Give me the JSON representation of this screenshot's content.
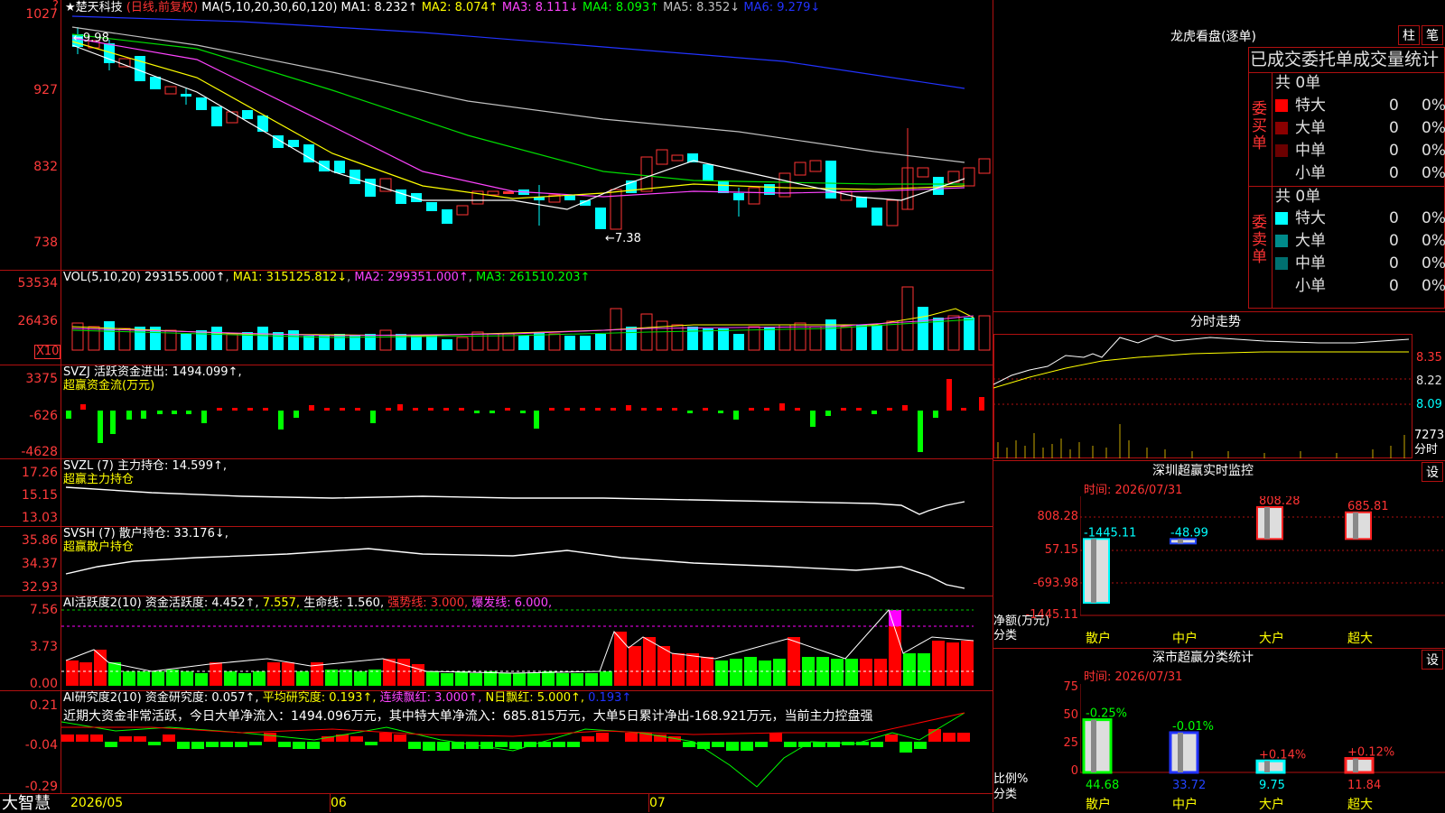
{
  "colors": {
    "up": "#ff3333",
    "down": "#00ffff",
    "ma1": "#ffffff",
    "ma2": "#ffff00",
    "ma3": "#ff44ff",
    "ma4": "#00dd00",
    "ma5": "#c0c0c0",
    "ma6": "#2233ff",
    "grid": "#b01010"
  },
  "main": {
    "stock_name": "楚天科技",
    "period_text": "(日线,前复权)",
    "ma_params": "MA(5,10,20,30,60,120)",
    "ma1": "MA1: 8.232↑",
    "ma2": "MA2: 8.074↑",
    "ma3": "MA3: 8.111↓",
    "ma4": "MA4: 8.093↑",
    "ma5": "MA5: 8.352↓",
    "ma6": "MA6: 9.279↓",
    "y_ticks": [
      "1027",
      "927",
      "832",
      "738"
    ],
    "high_label": "←9.98",
    "low_label": "←7.38"
  },
  "vol": {
    "title": "VOL(5,10,20)",
    "value": "293155.000↑",
    "ma1": "MA1: 315125.812↓",
    "ma2": "MA2: 299351.000↑",
    "ma3": "MA3: 261510.203↑",
    "y_ticks": [
      "53534",
      "26436"
    ],
    "unit": "X10"
  },
  "svzj": {
    "title": "SVZJ 活跃资金进出: 1494.099↑,",
    "subtitle": "超赢资金流(万元)",
    "y_ticks": [
      "3375",
      "-626",
      "-4628"
    ]
  },
  "svzl": {
    "title": "SVZL (7) 主力持仓: 14.599↑,",
    "subtitle": "超赢主力持仓",
    "y_ticks": [
      "17.26",
      "15.15",
      "13.03"
    ]
  },
  "svsh": {
    "title": "SVSH (7) 散户持仓: 33.176↓,",
    "subtitle": "超赢散户持仓",
    "y_ticks": [
      "35.86",
      "34.37",
      "32.93"
    ]
  },
  "ai1": {
    "title": "AI活跃度2(10) 资金活跃度: 4.452↑,",
    "v2": "7.557,",
    "life": "生命线: 1.560,",
    "strong": "强势线: 3.000,",
    "burst": "爆发线: 6.000,",
    "y_ticks": [
      "7.56",
      "3.73",
      "0.00"
    ]
  },
  "ai2": {
    "title": "AI研究度2(10) 资金研究度: 0.057↑,",
    "avg": "平均研究度: 0.193↑,",
    "lianxu": "连续飘红: 3.000↑,",
    "nday": "N日飘红: 5.000↑,",
    "last": "0.193↑",
    "comment": "近期大资金非常活跃，今日大单净流入：1494.096万元，其中特大单净流入：685.815万元，大单5日累计净出-168.921万元，当前主力控盘强",
    "y_ticks": [
      "0.21",
      "-0.04",
      "-0.29"
    ]
  },
  "x_axis": {
    "labels": [
      "2026/05",
      "06",
      "07"
    ]
  },
  "brand": "大智慧",
  "lhb": {
    "title": "龙虎看盘(逐单)",
    "btn1": "柱",
    "btn2": "笔",
    "header": "已成交委托单成交量统计",
    "buy": {
      "side_label": "委买单",
      "total": "共 0单",
      "rows": [
        {
          "name": "特大",
          "count": "0",
          "pct": "0%",
          "color": "#ff0000"
        },
        {
          "name": "大单",
          "count": "0",
          "pct": "0%",
          "color": "#8b0000"
        },
        {
          "name": "中单",
          "count": "0",
          "pct": "0%",
          "color": "#6b0000"
        },
        {
          "name": "小单",
          "count": "0",
          "pct": "0%",
          "color": "#000000"
        }
      ]
    },
    "sell": {
      "side_label": "委卖单",
      "total": "共 0单",
      "rows": [
        {
          "name": "特大",
          "count": "0",
          "pct": "0%",
          "color": "#00ffff"
        },
        {
          "name": "大单",
          "count": "0",
          "pct": "0%",
          "color": "#008b8b"
        },
        {
          "name": "中单",
          "count": "0",
          "pct": "0%",
          "color": "#007070"
        },
        {
          "name": "小单",
          "count": "0",
          "pct": "0%",
          "color": "#000000"
        }
      ]
    }
  },
  "intraday": {
    "title": "分时走势",
    "price_ticks": [
      "8.35",
      "8.22",
      "8.09"
    ],
    "vol_tick": "7273",
    "unit": "分时"
  },
  "sz_monitor": {
    "title": "深圳超赢实时监控",
    "set": "设",
    "time": "时间: 2026/07/31",
    "y_ticks": [
      "808.28",
      "57.15",
      "-693.98",
      "-1445.11"
    ],
    "ylabel": "净额(万元)",
    "xlabel": "分类",
    "chart_data": {
      "type": "bar",
      "categories": [
        "散户",
        "中户",
        "大户",
        "超大"
      ],
      "values": [
        -1445.11,
        -48.99,
        808.28,
        685.81
      ],
      "value_labels": [
        "-1445.11",
        "-48.99",
        "808.28",
        "685.81"
      ],
      "ylim": [
        -1445.11,
        808.28
      ]
    }
  },
  "sz_class": {
    "title": "深市超赢分类统计",
    "set": "设",
    "time": "时间: 2026/07/31",
    "y_ticks": [
      "75",
      "50",
      "25",
      "0"
    ],
    "ylabel": "比例%",
    "xlabel": "分类",
    "chart_data": {
      "type": "bar",
      "categories": [
        "散户",
        "中户",
        "大户",
        "超大"
      ],
      "values": [
        44.68,
        33.72,
        9.75,
        11.84
      ],
      "changes": [
        "-0.25%",
        "-0.01%",
        "+0.14%",
        "+0.12%"
      ],
      "ylim": [
        0,
        75
      ]
    }
  }
}
